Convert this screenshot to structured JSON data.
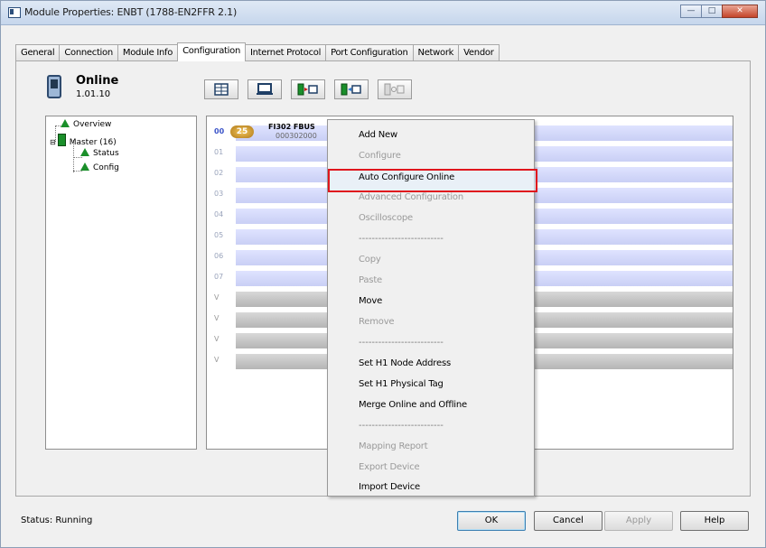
{
  "window": {
    "title": "Module Properties: ENBT (1788-EN2FFR 2.1)",
    "controls": [
      "minimize-icon",
      "maximize-icon",
      "close-icon"
    ]
  },
  "tabs": [
    {
      "label": "General"
    },
    {
      "label": "Connection"
    },
    {
      "label": "Module Info"
    },
    {
      "label": "Configuration",
      "active": true
    },
    {
      "label": "Internet Protocol"
    },
    {
      "label": "Port Configuration"
    },
    {
      "label": "Network"
    },
    {
      "label": "Vendor"
    }
  ],
  "device_status": {
    "state": "Online",
    "version": "1.01.10"
  },
  "toolbar": {
    "icons": [
      "grid-icon",
      "laptop-icon",
      "download-icon",
      "upload-icon",
      "sync-icon"
    ]
  },
  "tree": {
    "items": [
      {
        "label": "Overview"
      },
      {
        "label": "Master (16)"
      },
      {
        "label": "Status"
      },
      {
        "label": "Config"
      }
    ]
  },
  "slots": {
    "device": {
      "badge": "25",
      "name": "FI302 FBUS",
      "id": "000302000"
    },
    "rows": [
      "00",
      "01",
      "02",
      "03",
      "04",
      "05",
      "06",
      "07",
      "V",
      "V",
      "V",
      "V"
    ]
  },
  "context_menu": {
    "items": [
      {
        "label": "Add New",
        "enabled": true
      },
      {
        "label": "Configure",
        "enabled": false
      },
      {
        "label": "Auto Configure Online",
        "enabled": true,
        "highlighted": true
      },
      {
        "label": "Advanced Configuration",
        "enabled": false
      },
      {
        "label": "Oscilloscope",
        "enabled": false
      },
      {
        "label": "--------------------------",
        "separator": true
      },
      {
        "label": "Copy",
        "enabled": false
      },
      {
        "label": "Paste",
        "enabled": false
      },
      {
        "label": "Move",
        "enabled": true
      },
      {
        "label": "Remove",
        "enabled": false
      },
      {
        "label": "--------------------------",
        "separator": true
      },
      {
        "label": "Set H1 Node Address",
        "enabled": true
      },
      {
        "label": "Set H1 Physical Tag",
        "enabled": true
      },
      {
        "label": "Merge Online and Offline",
        "enabled": true
      },
      {
        "label": "--------------------------",
        "separator": true
      },
      {
        "label": "Mapping Report",
        "enabled": false
      },
      {
        "label": "Export Device",
        "enabled": false
      },
      {
        "label": "Import Device",
        "enabled": true
      }
    ]
  },
  "footer": {
    "status_label": "Status:",
    "status_value": "Running",
    "ok": "OK",
    "cancel": "Cancel",
    "apply": "Apply",
    "help": "Help"
  },
  "colors": {
    "highlight_border": "#e0161d",
    "tree_icon": "#1a8f2a",
    "slot_bar": "#d3d8fa"
  }
}
